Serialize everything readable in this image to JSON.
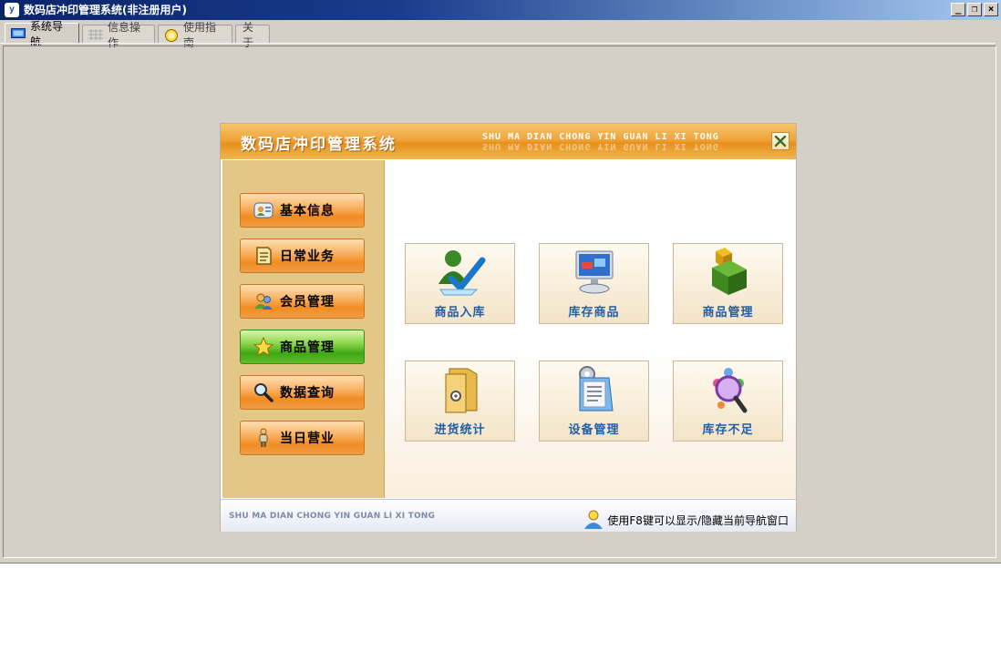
{
  "window": {
    "title": "数码店冲印管理系统(非注册用户)",
    "icon_label": "y",
    "controls": {
      "minimize": "_",
      "restore": "❐",
      "close": "×"
    }
  },
  "tabs": [
    {
      "label": "系统导航",
      "icon": "monitor-icon",
      "active": true
    },
    {
      "label": "信息操作",
      "icon": "grid-icon",
      "active": false
    },
    {
      "label": "使用指南",
      "icon": "help-icon",
      "active": false
    },
    {
      "label": "关于",
      "icon": "",
      "active": false
    }
  ],
  "nav_panel": {
    "title": "数码店冲印管理系统",
    "pinyin": "SHU MA DIAN CHONG YIN GUAN LI XI TONG",
    "side_buttons": [
      {
        "label": "基本信息",
        "icon": "id-card-icon"
      },
      {
        "label": "日常业务",
        "icon": "document-icon"
      },
      {
        "label": "会员管理",
        "icon": "users-icon"
      },
      {
        "label": "商品管理",
        "icon": "star-icon",
        "selected": true
      },
      {
        "label": "数据查询",
        "icon": "magnifier-icon"
      },
      {
        "label": "当日营业",
        "icon": "person-icon"
      }
    ],
    "tiles": [
      {
        "label": "商品入库",
        "icon": "user-check-icon"
      },
      {
        "label": "库存商品",
        "icon": "computer-icon"
      },
      {
        "label": "商品管理",
        "icon": "boxes-icon"
      },
      {
        "label": "进货统计",
        "icon": "folder-icon"
      },
      {
        "label": "设备管理",
        "icon": "clipboard-gear-icon"
      },
      {
        "label": "库存不足",
        "icon": "search-people-icon"
      }
    ],
    "footer_left": "SHU MA DIAN CHONG YIN GUAN LI XI TONG",
    "footer_hint": "使用F8键可以显示/隐藏当前导航窗口"
  },
  "colors": {
    "titlebar": "#0a246a",
    "header_orange": "#f0a43a",
    "sidebar_bg": "#e2c786",
    "tile_label": "#1f5fa6",
    "window_bg": "#d4d0c8"
  }
}
